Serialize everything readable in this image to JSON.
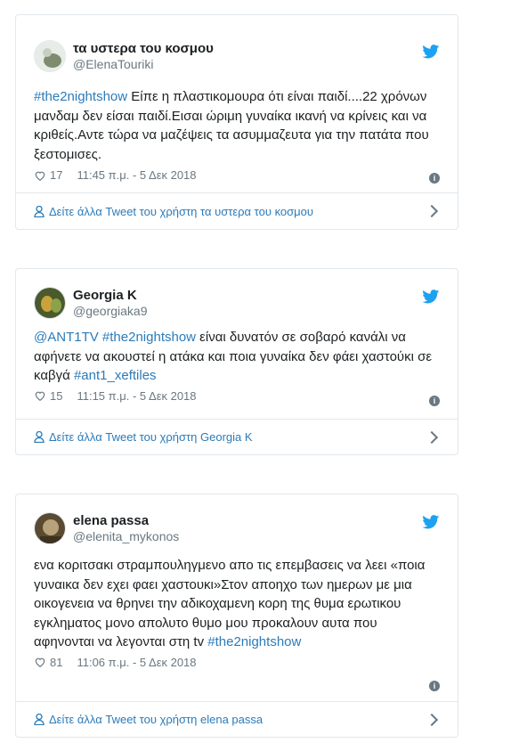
{
  "tweets": [
    {
      "display_name": "τα υστερα του κοσμου",
      "handle": "@ElenaTouriki",
      "text_parts": [
        {
          "t": "#the2nightshow",
          "link": true
        },
        {
          "t": " Είπε η πλαστικομουρα ότι είναι παιδί....22 χρόνων μανδαμ δεν είσαι παιδί.Εισαι ώριμη γυναίκα ικανή να κρίνεις και να κριθείς.Αντε τώρα να μαζέψεις τα ασυμμαζευτα για την πατάτα που ξεστομισες.",
          "link": false
        }
      ],
      "likes": "17",
      "timestamp": "11:45 π.μ. - 5 Δεκ 2018",
      "footer": "Δείτε άλλα Tweet του χρήστη τα υστερα του κοσμου",
      "avatar_colors": [
        "#e8ece6",
        "#7d8c6e"
      ]
    },
    {
      "display_name": "Georgia K",
      "handle": "@georgiaka9",
      "text_parts": [
        {
          "t": "@ANT1TV",
          "link": true
        },
        {
          "t": " ",
          "link": false
        },
        {
          "t": "#the2nightshow",
          "link": true
        },
        {
          "t": " είναι δυνατόν σε σοβαρό κανάλι να αφήνετε να ακουστεί η ατάκα και ποια γυναίκα δεν φάει χαστούκι σε καβγά ",
          "link": false
        },
        {
          "t": "#ant1_xeftiles",
          "link": true
        }
      ],
      "likes": "15",
      "timestamp": "11:15 π.μ. - 5 Δεκ 2018",
      "footer": "Δείτε άλλα Tweet του χρήστη Georgia K",
      "avatar_colors": [
        "#4b5a2d",
        "#c9a23b"
      ]
    },
    {
      "display_name": "elena passa",
      "handle": "@elenita_mykonos",
      "text_parts": [
        {
          "t": "ενα κοριτσακι στραμπουληγμενο απο τις επεμβασεις να λεει «ποια γυναικα δεν εχει φαει χαστουκι»Στον αποηχο των ημερων με μια οικογενεια να θρηνει την αδικοχαμενη κορη της θυμα ερωτικου εγκληματος μονο απολυτο θυμο μου προκαλουν αυτα που αφηνονται να λεγονται στη tv ",
          "link": false
        },
        {
          "t": "#the2nightshow",
          "link": true
        }
      ],
      "likes": "81",
      "timestamp": "11:06 π.μ. - 5 Δεκ 2018",
      "footer": "Δείτε άλλα Tweet του χρήστη elena passa",
      "avatar_colors": [
        "#5a4a32",
        "#b8a27a"
      ]
    }
  ],
  "colors": {
    "link": "#2b7bb9",
    "twitter_blue": "#1da1f2",
    "meta_gray": "#697882",
    "border": "#e1e8ed"
  }
}
